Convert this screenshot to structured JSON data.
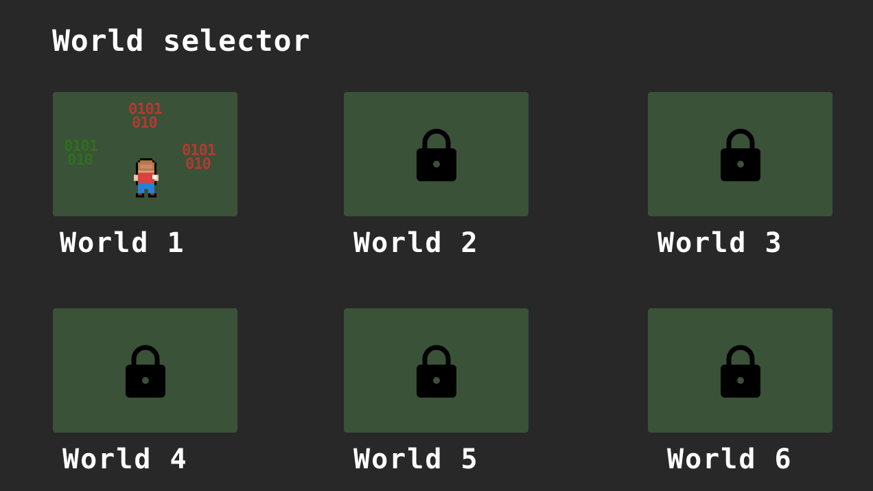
{
  "page": {
    "title": "World selector",
    "background": "#282828"
  },
  "theme": {
    "card_color": "#3a5237",
    "lock_color": "#000000",
    "text_color": "#ffffff"
  },
  "worlds": [
    {
      "label": "World 1",
      "locked": false,
      "icon": "world-preview"
    },
    {
      "label": "World 2",
      "locked": true,
      "icon": "lock-icon"
    },
    {
      "label": "World 3",
      "locked": true,
      "icon": "lock-icon"
    },
    {
      "label": "World 4",
      "locked": true,
      "icon": "lock-icon"
    },
    {
      "label": "World 5",
      "locked": true,
      "icon": "lock-icon"
    },
    {
      "label": "World 6",
      "locked": true,
      "icon": "lock-icon"
    }
  ],
  "preview": {
    "binary_green": {
      "line1": "0101",
      "line2": "010",
      "color": "#2f6f1f"
    },
    "binary_red_1": {
      "line1": "0101",
      "line2": "010",
      "color": "#b03a32"
    },
    "binary_red_2": {
      "line1": "0101",
      "line2": "010",
      "color": "#b03a32"
    },
    "character": "player-sprite"
  }
}
